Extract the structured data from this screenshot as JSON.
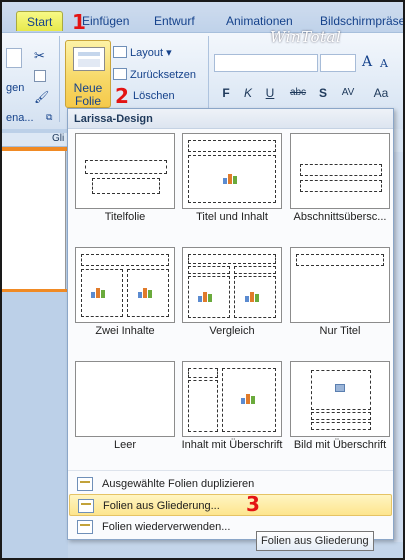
{
  "ribbon": {
    "tabs": [
      "Start",
      "Einfügen",
      "Entwurf",
      "Animationen",
      "Bildschirmpräse"
    ],
    "active_tab": "Start",
    "watermark": "WinTotal",
    "clipboard_partial": "gen",
    "clipboard_group_partial": "ena...",
    "new_slide_line1": "Neue",
    "new_slide_line2": "Folie",
    "layout_label": "Layout",
    "reset_label": "Zurücksetzen",
    "delete_label": "Löschen",
    "format_buttons": [
      "F",
      "K",
      "U",
      "abc",
      "S",
      "AV",
      "Aa"
    ],
    "doc_tab_partial": "Gli"
  },
  "markers": [
    "1",
    "2",
    "3"
  ],
  "dropdown": {
    "header": "Larissa-Design",
    "layouts": [
      {
        "label": "Titelfolie"
      },
      {
        "label": "Titel und Inhalt"
      },
      {
        "label": "Abschnittsübersc..."
      },
      {
        "label": "Zwei Inhalte"
      },
      {
        "label": "Vergleich"
      },
      {
        "label": "Nur Titel"
      },
      {
        "label": "Leer"
      },
      {
        "label": "Inhalt mit Überschrift"
      },
      {
        "label": "Bild mit Überschrift"
      }
    ],
    "menu_items": [
      {
        "label": "Ausgewählte Folien duplizieren",
        "highlighted": false
      },
      {
        "label": "Folien aus Gliederung...",
        "highlighted": true
      },
      {
        "label": "Folien wiederverwenden...",
        "highlighted": false
      }
    ]
  },
  "tooltip": "Folien aus Gliederung",
  "colors": {
    "highlight": "#fde58e",
    "marker": "#e31414",
    "active_tab": "#e7e94c"
  }
}
